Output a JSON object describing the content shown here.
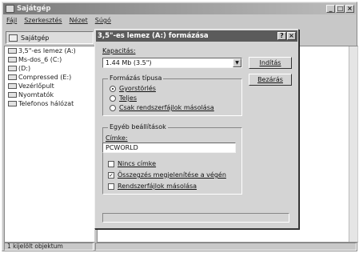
{
  "window": {
    "title": "Sajátgép",
    "controls": [
      "_",
      "□",
      "×"
    ]
  },
  "menu": {
    "items": [
      {
        "label": "Fájl"
      },
      {
        "label": "Szerkesztés"
      },
      {
        "label": "Nézet"
      },
      {
        "label": "Súgó"
      }
    ]
  },
  "address": {
    "label": "Sajátgép",
    "icon": "computer-icon"
  },
  "tree": {
    "items": [
      {
        "label": "3,5\"-es lemez (A:)",
        "icon": "floppy-icon"
      },
      {
        "label": "Ms-dos_6 (C:)",
        "icon": "hard-disk-icon"
      },
      {
        "label": "(D:)",
        "icon": "cd-drive-icon"
      },
      {
        "label": "Compressed (E:)",
        "icon": "hard-disk-icon"
      },
      {
        "label": "Vezérlőpult",
        "icon": "control-panel-icon"
      },
      {
        "label": "Nyomtatók",
        "icon": "printer-icon"
      },
      {
        "label": "Telefonos hálózat",
        "icon": "network-icon"
      }
    ]
  },
  "status": {
    "text": "1 kijelölt objektum"
  },
  "dialog": {
    "title": "3,5\"-es lemez (A:) formázása",
    "controls": [
      "?",
      "×"
    ],
    "capacity_label": "Kapacitás:",
    "capacity_value": "1.44 Mb (3.5\")",
    "start_button": "Indítás",
    "close_button": "Bezárás",
    "format_type_legend": "Formázás típusa",
    "format_options": [
      {
        "label": "Gyorstörlés",
        "selected": true
      },
      {
        "label": "Teljes",
        "selected": false
      },
      {
        "label": "Csak rendszerfájlok másolása",
        "selected": false
      }
    ],
    "other_settings_legend": "Egyéb beállítások",
    "label_label": "Címke:",
    "label_value": "PCWORLD",
    "checkboxes": [
      {
        "label": "Nincs címke",
        "checked": false
      },
      {
        "label": "Összegzés megjelenítése a végén",
        "checked": true
      },
      {
        "label": "Rendszerfájlok másolása",
        "checked": false
      }
    ]
  }
}
